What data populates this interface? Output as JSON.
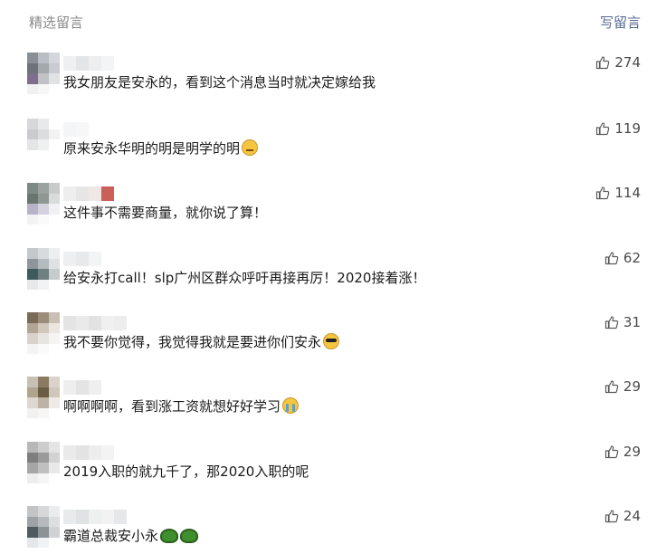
{
  "header": {
    "title": "精选留言",
    "write_label": "写留言"
  },
  "comments": [
    {
      "text": "我女朋友是安永的，看到这个消息当时就决定嫁给我",
      "likes": "274",
      "emoji": []
    },
    {
      "text": "原来安永华明的明是明学的明",
      "likes": "119",
      "emoji": [
        "thinking-face"
      ]
    },
    {
      "text": "这件事不需要商量，就你说了算！",
      "likes": "114",
      "emoji": []
    },
    {
      "text": "给安永打call！slp广州区群众呼吁再接再厉！2020接着涨！",
      "likes": "62",
      "emoji": []
    },
    {
      "text": "我不要你觉得，我觉得我就是要进你们安永",
      "likes": "31",
      "emoji": [
        "sunglasses-face"
      ]
    },
    {
      "text": "啊啊啊啊，看到涨工资就想好好学习",
      "likes": "29",
      "emoji": [
        "crying-face"
      ]
    },
    {
      "text": "2019入职的就九千了，那2020入职的呢",
      "likes": "29",
      "emoji": []
    },
    {
      "text": "霸道总裁安小永",
      "likes": "24",
      "emoji": [
        "turtle",
        "turtle"
      ]
    }
  ],
  "icons": {
    "like": "thumbs-up-icon"
  },
  "colors": {
    "link": "#576b95",
    "muted": "#8a8a8a"
  }
}
